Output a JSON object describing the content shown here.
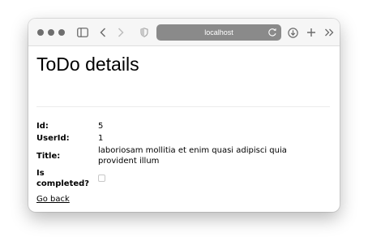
{
  "browser": {
    "url": "localhost"
  },
  "page": {
    "title": "ToDo details",
    "fields": [
      {
        "label": "Id:",
        "value": "5"
      },
      {
        "label": "UserId:",
        "value": "1"
      },
      {
        "label": "Title:",
        "value": "laboriosam mollitia et enim quasi adipisci quia provident illum"
      },
      {
        "label": "Is completed?",
        "checked": false
      }
    ],
    "back_link": "Go back"
  }
}
